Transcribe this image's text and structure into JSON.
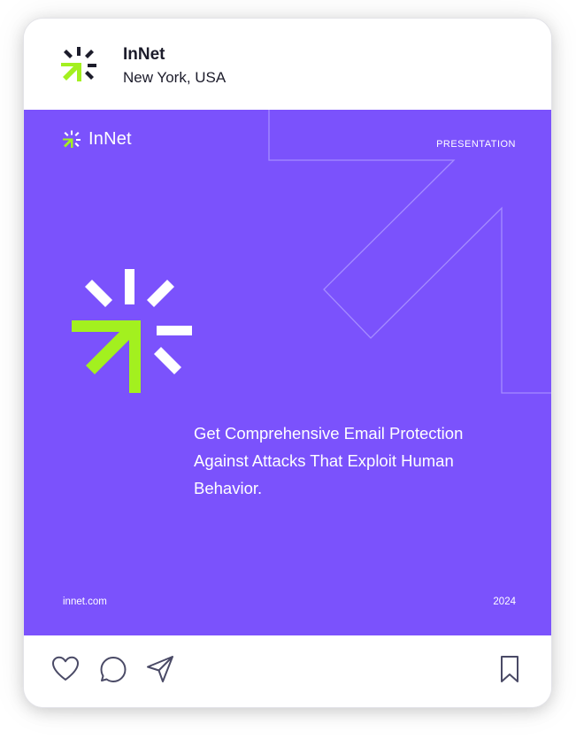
{
  "profile": {
    "name": "InNet",
    "location": "New York, USA"
  },
  "post": {
    "brand": "InNet",
    "label": "PRESENTATION",
    "headline_lines": [
      "Get Comprehensive Email Protection",
      "Against Attacks That Exploit Human",
      "Behavior."
    ],
    "website": "innet.com",
    "year": "2024"
  },
  "colors": {
    "post_bg": "#7b52fc",
    "accent_green": "#a3f01f",
    "dark": "#1c1c2b",
    "icon_stroke": "#4a4a66"
  },
  "actions": {
    "icons": [
      "heart-icon",
      "comment-icon",
      "share-icon",
      "bookmark-icon"
    ]
  }
}
